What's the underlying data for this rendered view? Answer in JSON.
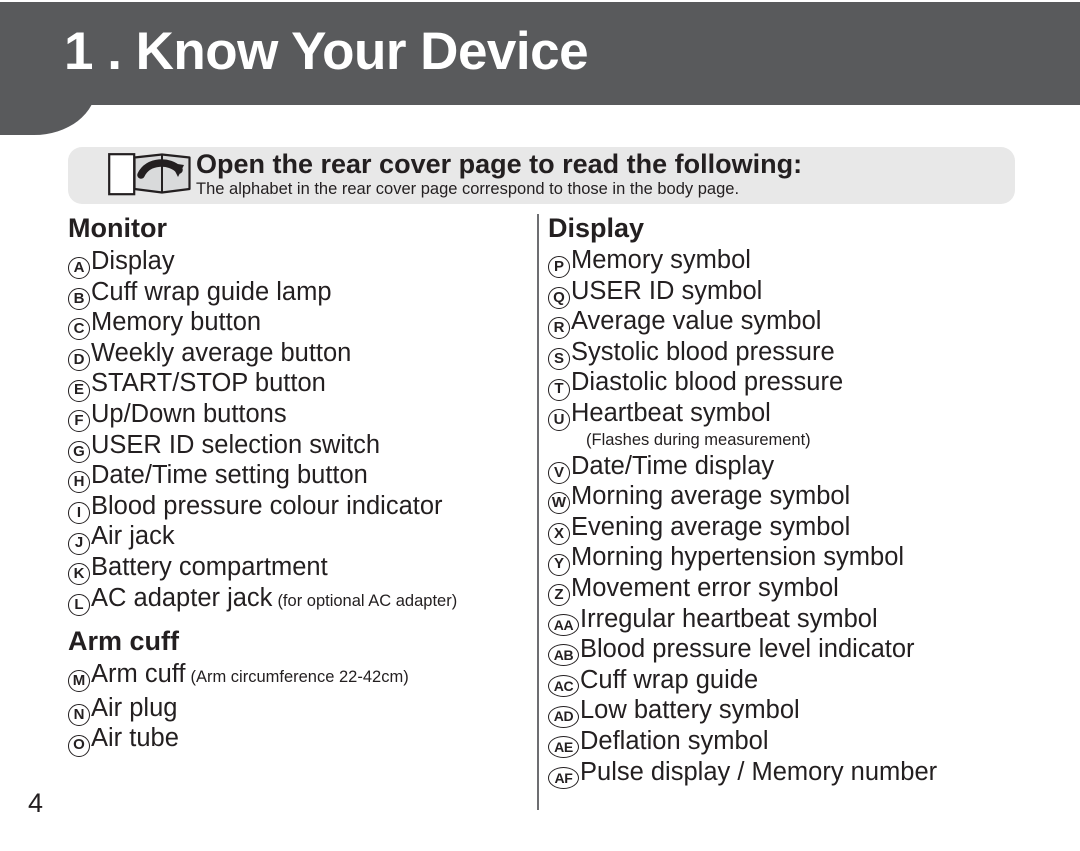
{
  "header": {
    "title": "1 . Know Your Device"
  },
  "callout": {
    "icon": "open-book-icon",
    "heading": "Open the rear cover page to read the following:",
    "note": "The alphabet in the rear cover page correspond to those in the body page."
  },
  "left_column": {
    "sections": [
      {
        "title": "Monitor",
        "items": [
          {
            "marker": "A",
            "label": "Display",
            "paren": ""
          },
          {
            "marker": "B",
            "label": "Cuff wrap guide lamp",
            "paren": ""
          },
          {
            "marker": "C",
            "label": "Memory button",
            "paren": ""
          },
          {
            "marker": "D",
            "label": "Weekly average button",
            "paren": ""
          },
          {
            "marker": "E",
            "label": "START/STOP button",
            "paren": ""
          },
          {
            "marker": "F",
            "label": "Up/Down buttons",
            "paren": ""
          },
          {
            "marker": "G",
            "label": "USER ID selection switch",
            "paren": ""
          },
          {
            "marker": "H",
            "label": "Date/Time setting button",
            "paren": ""
          },
          {
            "marker": "I",
            "label": "Blood pressure colour indicator",
            "paren": ""
          },
          {
            "marker": "J",
            "label": "Air jack",
            "paren": ""
          },
          {
            "marker": "K",
            "label": "Battery compartment",
            "paren": ""
          },
          {
            "marker": "L",
            "label": "AC adapter jack",
            "paren": "(for optional AC adapter)"
          }
        ]
      },
      {
        "title": "Arm cuff",
        "items": [
          {
            "marker": "M",
            "label": "Arm cuff",
            "paren": "(Arm circumference 22-42cm)"
          },
          {
            "marker": "N",
            "label": "Air plug",
            "paren": ""
          },
          {
            "marker": "O",
            "label": "Air tube",
            "paren": ""
          }
        ]
      }
    ]
  },
  "right_column": {
    "sections": [
      {
        "title": "Display",
        "items": [
          {
            "marker": "P",
            "label": "Memory symbol",
            "paren": ""
          },
          {
            "marker": "Q",
            "label": "USER ID symbol",
            "paren": ""
          },
          {
            "marker": "R",
            "label": "Average value symbol",
            "paren": ""
          },
          {
            "marker": "S",
            "label": "Systolic blood pressure",
            "paren": ""
          },
          {
            "marker": "T",
            "label": "Diastolic blood pressure",
            "paren": ""
          },
          {
            "marker": "U",
            "label": "Heartbeat symbol",
            "paren": "",
            "subnote": "(Flashes during measurement)"
          },
          {
            "marker": "V",
            "label": "Date/Time display",
            "paren": ""
          },
          {
            "marker": "W",
            "label": "Morning average symbol",
            "paren": ""
          },
          {
            "marker": "X",
            "label": "Evening average symbol",
            "paren": ""
          },
          {
            "marker": "Y",
            "label": "Morning hypertension symbol",
            "paren": ""
          },
          {
            "marker": "Z",
            "label": "Movement error symbol",
            "paren": ""
          },
          {
            "marker": "AA",
            "label": "Irregular heartbeat symbol",
            "paren": ""
          },
          {
            "marker": "AB",
            "label": "Blood pressure level indicator",
            "paren": ""
          },
          {
            "marker": "AC",
            "label": "Cuff wrap guide",
            "paren": ""
          },
          {
            "marker": "AD",
            "label": "Low battery symbol",
            "paren": ""
          },
          {
            "marker": "AE",
            "label": "Deflation symbol",
            "paren": ""
          },
          {
            "marker": "AF",
            "label": "Pulse display / Memory number",
            "paren": ""
          }
        ]
      }
    ]
  },
  "footer": {
    "page_number": "4"
  },
  "colors": {
    "header_bar": "#595a5c",
    "callout_bg": "#e8e8e8",
    "text": "#231f20",
    "divider": "#6d6e71"
  }
}
